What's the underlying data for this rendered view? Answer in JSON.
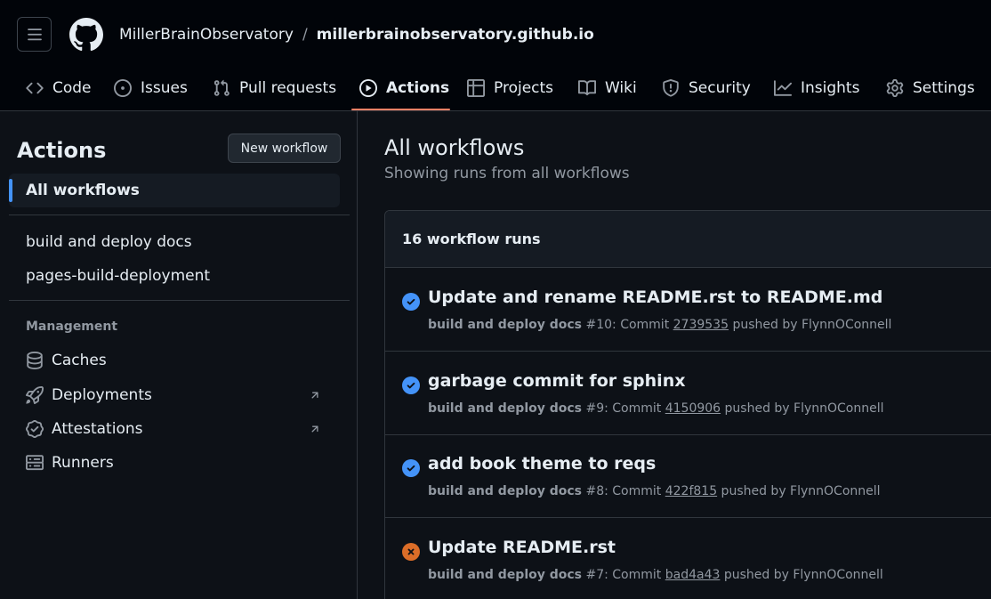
{
  "header": {
    "owner": "MillerBrainObservatory",
    "separator": "/",
    "repo": "millerbrainobservatory.github.io",
    "menu_icon": "hamburger-icon",
    "logo_icon": "github-logo-icon"
  },
  "tabs": [
    {
      "label": "Code",
      "icon": "code-icon"
    },
    {
      "label": "Issues",
      "icon": "issue-opened-icon"
    },
    {
      "label": "Pull requests",
      "icon": "git-pull-request-icon"
    },
    {
      "label": "Actions",
      "icon": "play-icon",
      "selected": true
    },
    {
      "label": "Projects",
      "icon": "table-icon"
    },
    {
      "label": "Wiki",
      "icon": "book-icon"
    },
    {
      "label": "Security",
      "icon": "shield-icon"
    },
    {
      "label": "Insights",
      "icon": "graph-icon"
    },
    {
      "label": "Settings",
      "icon": "gear-icon"
    }
  ],
  "sidebar": {
    "title": "Actions",
    "new_workflow": "New workflow",
    "all_workflows": "All workflows",
    "workflows": [
      "build and deploy docs",
      "pages-build-deployment"
    ],
    "management_label": "Management",
    "management": [
      {
        "label": "Caches",
        "icon": "database-icon"
      },
      {
        "label": "Deployments",
        "icon": "rocket-icon",
        "external": true
      },
      {
        "label": "Attestations",
        "icon": "verified-icon",
        "external": true
      },
      {
        "label": "Runners",
        "icon": "server-icon"
      }
    ]
  },
  "main": {
    "title": "All workflows",
    "subtitle": "Showing runs from all workflows",
    "runs_count": "16 workflow runs",
    "runs": [
      {
        "status": "success",
        "title": "Update and rename README.rst to README.md",
        "workflow": "build and deploy docs",
        "detail": " #10: Commit ",
        "sha": "2739535",
        "pushed": " pushed by FlynnOConnell"
      },
      {
        "status": "success",
        "title": "garbage commit for sphinx",
        "workflow": "build and deploy docs",
        "detail": " #9: Commit ",
        "sha": "4150906",
        "pushed": " pushed by FlynnOConnell"
      },
      {
        "status": "success",
        "title": "add book theme to reqs",
        "workflow": "build and deploy docs",
        "detail": " #8: Commit ",
        "sha": "422f815",
        "pushed": " pushed by FlynnOConnell"
      },
      {
        "status": "failure",
        "title": "Update README.rst",
        "workflow": "build and deploy docs",
        "detail": " #7: Commit ",
        "sha": "bad4a43",
        "pushed": " pushed by FlynnOConnell"
      }
    ]
  },
  "colors": {
    "background": "#0d1117",
    "header_bg": "#010409",
    "border": "#30363d",
    "accent_underline": "#f78166",
    "active_bar": "#4493f8",
    "success": "#4493f8",
    "failure": "#db6d28",
    "muted_text": "#9198a1"
  }
}
